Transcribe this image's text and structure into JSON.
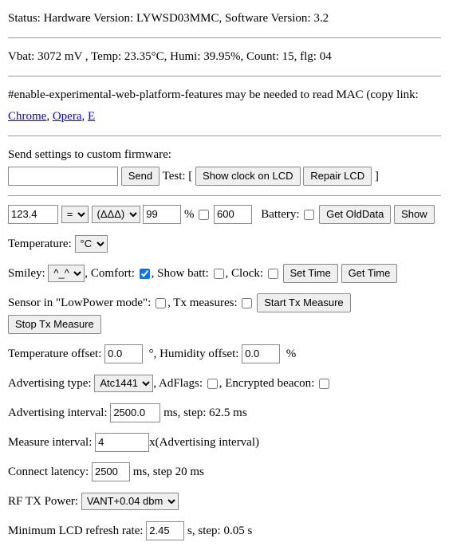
{
  "status": {
    "prefix": "Status: Hardware Version: ",
    "hw": "LYWSD03MMC",
    "sw_label": ", Software Version: ",
    "sw": "3.2"
  },
  "readings": {
    "vbat_label": "Vbat: ",
    "vbat": "3072 mV",
    "temp_label": " , Temp: ",
    "temp": "23.35°C",
    "humi_label": ", Humi: ",
    "humi": "39.95%",
    "count_label": ", Count: ",
    "count": "15",
    "flg_label": ", flg: ",
    "flg": "04"
  },
  "note": {
    "text": "#enable-experimental-web-platform-features may be needed to read MAC (copy link: ",
    "link_chrome": "Chrome",
    "link_opera": "Opera",
    "link_e": "E"
  },
  "send": {
    "label": "Send settings to custom firmware:",
    "input": "",
    "send_btn": "Send",
    "test_label": " Test: [ ",
    "show_clock_btn": "Show clock on LCD",
    "repair_btn": "Repair LCD",
    "close_bracket": " ]"
  },
  "row1": {
    "value": "123.4",
    "eq_sel": "=",
    "tri_sel": "(ΔΔΔ)",
    "pct_val": "99",
    "pct_label": "%",
    "box_val": "600",
    "battery_label": "Battery: ",
    "get_old_btn": "Get OldData",
    "show_btn": "Show"
  },
  "temp_row": {
    "label": "Temperature: ",
    "unit_sel": "°C"
  },
  "smiley_row": {
    "label": "Smiley: ",
    "sel": "^_^",
    "comfort_label": ", Comfort: ",
    "showbatt_label": ", Show batt: ",
    "clock_label": ", Clock: ",
    "set_time_btn": "Set Time",
    "get_time_btn": "Get Time"
  },
  "sensor_row": {
    "label": "Sensor in \"LowPower mode\": ",
    "tx_label": ", Tx measures: ",
    "start_btn": "Start Tx Measure",
    "stop_btn": "Stop Tx Measure"
  },
  "offset_row": {
    "temp_label": "Temperature offset: ",
    "temp_val": "0.0",
    "deg_label": "°, Humidity offset: ",
    "humi_val": "0.0",
    "pct_label": "%"
  },
  "adv_row": {
    "label": "Advertising type: ",
    "sel": "Atc1441",
    "flags_label": ", AdFlags: ",
    "enc_label": ", Encrypted beacon: "
  },
  "advint_row": {
    "label": "Advertising interval: ",
    "val": "2500.0",
    "suffix": " ms, step: 62.5 ms"
  },
  "meas_row": {
    "label": "Measure interval: ",
    "val": "4",
    "suffix": "x(Advertising interval)"
  },
  "lat_row": {
    "label": "Connect latency: ",
    "val": "2500",
    "suffix": " ms, step 20 ms"
  },
  "rf_row": {
    "label": "RF TX Power: ",
    "sel": "VANT+0.04 dbm"
  },
  "lcd_row": {
    "label": "Minimum LCD refresh rate: ",
    "val": "2.45",
    "suffix": " s, step: 0.05 s"
  }
}
